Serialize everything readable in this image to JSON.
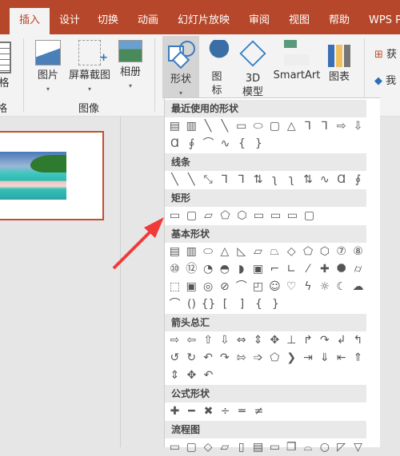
{
  "tabs": [
    {
      "label": "插入",
      "active": true
    },
    {
      "label": "设计"
    },
    {
      "label": "切换"
    },
    {
      "label": "动画"
    },
    {
      "label": "幻灯片放映"
    },
    {
      "label": "审阅"
    },
    {
      "label": "视图"
    },
    {
      "label": "帮助"
    },
    {
      "label": "WPS P"
    }
  ],
  "ribbon": {
    "table_label": "格",
    "table_group": "格",
    "picture": "图片",
    "screenshot": "屏幕截图",
    "album": "相册",
    "image_group": "图像",
    "shapes": "形状",
    "icons": "图\n标",
    "icons1": "图",
    "icons2": "标",
    "model1": "3D",
    "model2": "模型",
    "smartart": "SmartArt",
    "chart": "图表",
    "get": "获",
    "my": "我"
  },
  "colors": {
    "accent": "#b7472a",
    "arrow": "#f03a3a"
  },
  "shapes_menu": {
    "sections": [
      {
        "title": "最近使用的形状",
        "rows": [
          [
            "▤",
            "▥",
            "╲",
            "╲",
            "▭",
            "⬭",
            "▢",
            "△",
            "⅂",
            "⅂",
            "⇨",
            "⇩"
          ],
          [
            "Ɑ",
            "∮",
            "⌒",
            "∿",
            "{",
            "}"
          ]
        ]
      },
      {
        "title": "线条",
        "rows": [
          [
            "╲",
            "╲",
            "⤡",
            "⅂",
            "⅂",
            "⇅",
            "ʅ",
            "ʅ",
            "⇅",
            "∿",
            "Ɑ",
            "∮"
          ]
        ]
      },
      {
        "title": "矩形",
        "rows": [
          [
            "▭",
            "▢",
            "▱",
            "⬠",
            "⬡",
            "▭",
            "▭",
            "▭",
            "▢"
          ]
        ]
      },
      {
        "title": "基本形状",
        "rows": [
          [
            "▤",
            "▥",
            "⬭",
            "△",
            "◺",
            "▱",
            "⏢",
            "◇",
            "⬠",
            "⬡",
            "⑦",
            "⑧"
          ],
          [
            "⑩",
            "⑫",
            "◔",
            "◓",
            "◗",
            "▣",
            "⌐",
            "∟",
            "⁄",
            "✚",
            "⯃",
            "⌭"
          ],
          [
            "⬚",
            "▣",
            "◎",
            "⊘",
            "⌒",
            "◰",
            "☺",
            "♡",
            "ϟ",
            "☼",
            "☾",
            "☁"
          ],
          [
            "⌒",
            "()",
            "{}",
            "[",
            "]",
            "{",
            "}"
          ]
        ]
      },
      {
        "title": "箭头总汇",
        "rows": [
          [
            "⇨",
            "⇦",
            "⇧",
            "⇩",
            "⇔",
            "⇕",
            "✥",
            "⊥",
            "↱",
            "↷",
            "↲",
            "↰"
          ],
          [
            "↺",
            "↻",
            "↶",
            "↷",
            "⇰",
            "➩",
            "⬠",
            "❯",
            "⇥",
            "⇓",
            "⇤",
            "⇑"
          ],
          [
            "⇕",
            "✥",
            "↶"
          ]
        ]
      },
      {
        "title": "公式形状",
        "rows": [
          [
            "✚",
            "━",
            "✖",
            "÷",
            "═",
            "≠"
          ]
        ]
      },
      {
        "title": "流程图",
        "rows": [
          [
            "▭",
            "▢",
            "◇",
            "▱",
            "▯",
            "▤",
            "▭",
            "❐",
            "⌓",
            "○",
            "◸",
            "▽"
          ]
        ]
      }
    ]
  }
}
